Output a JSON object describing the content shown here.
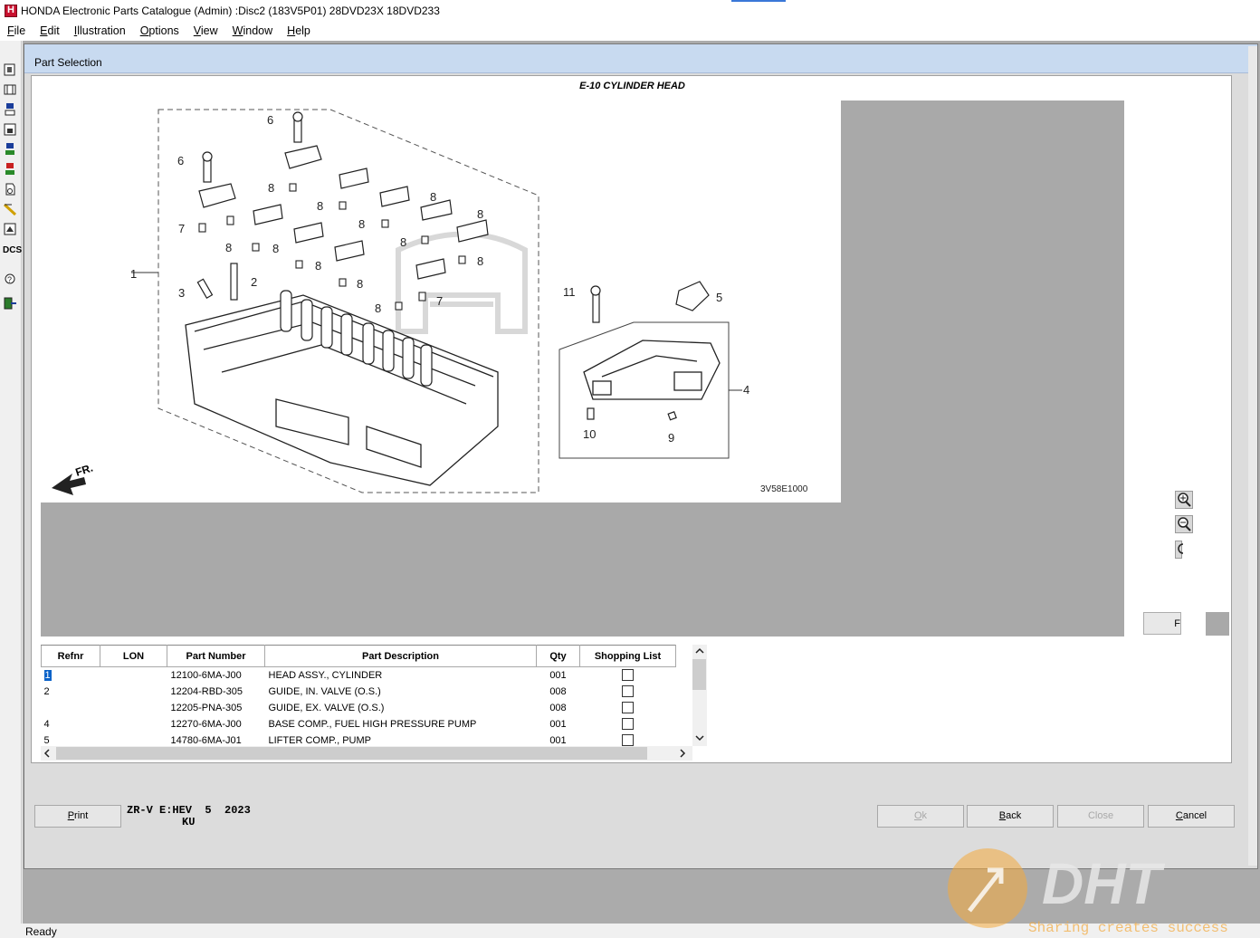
{
  "window": {
    "title": "HONDA Electronic Parts Catalogue  (Admin)  :Disc2  (183V5P01)  28DVD23X  18DVD233"
  },
  "menu": [
    {
      "label": "File",
      "key": "F",
      "rest": "ile"
    },
    {
      "label": "Edit",
      "key": "E",
      "rest": "dit"
    },
    {
      "label": "Illustration",
      "key": "I",
      "rest": "llustration"
    },
    {
      "label": "Options",
      "key": "O",
      "rest": "ptions"
    },
    {
      "label": "View",
      "key": "V",
      "rest": "iew"
    },
    {
      "label": "Window",
      "key": "W",
      "rest": "indow"
    },
    {
      "label": "Help",
      "key": "H",
      "rest": "elp"
    }
  ],
  "toolbar": {
    "dcs_label": "DCS",
    "icons": [
      "catalog-icon",
      "vehicle-icon",
      "search-part-icon",
      "frame-icon",
      "model-icon",
      "parts-icon",
      "document-icon",
      "pencil-icon",
      "print-preview-icon",
      "dcs-icon",
      "help-icon",
      "exit-icon"
    ]
  },
  "child": {
    "title": "Part Selection",
    "diagram_title": "E-10 CYLINDER HEAD",
    "illustration_code": "3V58E1000",
    "fr_label": "FR.",
    "callouts": [
      "1",
      "2",
      "3",
      "4",
      "5",
      "6",
      "6",
      "7",
      "7",
      "8",
      "8",
      "8",
      "8",
      "8",
      "8",
      "8",
      "8",
      "8",
      "8",
      "8",
      "8",
      "9",
      "10",
      "11"
    ],
    "right_button_label": "F",
    "zoom": [
      "zoom-in-icon",
      "zoom-out-icon",
      "zoom-reset-icon"
    ]
  },
  "table": {
    "headers": [
      "Refnr",
      "LON",
      "Part Number",
      "Part Description",
      "Qty",
      "Shopping List"
    ],
    "rows": [
      {
        "refnr": "1",
        "lon": "",
        "part_number": "12100-6MA-J00",
        "description": "HEAD ASSY., CYLINDER",
        "qty": "001",
        "selected": true
      },
      {
        "refnr": "2",
        "lon": "",
        "part_number": "12204-RBD-305",
        "description": "GUIDE, IN. VALVE (O.S.)",
        "qty": "008",
        "selected": false
      },
      {
        "refnr": "",
        "lon": "",
        "part_number": "12205-PNA-305",
        "description": "GUIDE, EX. VALVE (O.S.)",
        "qty": "008",
        "selected": false
      },
      {
        "refnr": "4",
        "lon": "",
        "part_number": "12270-6MA-J00",
        "description": "BASE COMP., FUEL HIGH PRESSURE PUMP",
        "qty": "001",
        "selected": false
      },
      {
        "refnr": "5",
        "lon": "",
        "part_number": "14780-6MA-J01",
        "description": "LIFTER COMP., PUMP",
        "qty": "001",
        "selected": false
      }
    ]
  },
  "vehicle": {
    "line1": "ZR-V E:HEV  5  2023",
    "line2": "KU"
  },
  "buttons": {
    "print": {
      "key": "P",
      "rest": "rint"
    },
    "ok": {
      "key": "O",
      "rest": "k"
    },
    "back": {
      "key": "B",
      "rest": "ack"
    },
    "close": {
      "label": "Close"
    },
    "cancel": {
      "key": "C",
      "rest": "ancel"
    }
  },
  "status": "Ready",
  "watermark": {
    "logo": "DHT",
    "tagline": "Sharing creates success"
  },
  "colors": {
    "title_bg": "#c8daf0",
    "selection": "#0a62c8",
    "mdi_bg": "#ababab",
    "watermark_orange": "#f4a93c"
  }
}
